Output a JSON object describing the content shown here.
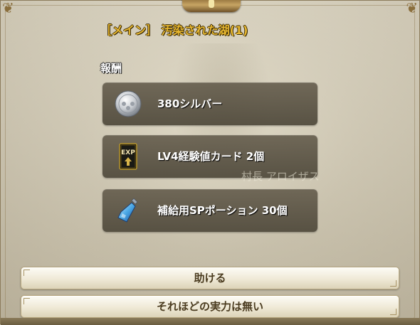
{
  "quest": {
    "title": "［メイン］ 汚染された湖(1)"
  },
  "rewards": {
    "heading": "報酬",
    "items": [
      {
        "label": "380シルバー",
        "icon": "silver-coin-icon"
      },
      {
        "label": "LV4経験値カード 2個",
        "icon": "exp-card-icon",
        "icon_text": "EXP"
      },
      {
        "label": "補給用SPポーション 30個",
        "icon": "sp-potion-icon"
      }
    ]
  },
  "npc": {
    "name": "村長 アロイザス"
  },
  "actions": {
    "accept_label": "助ける",
    "decline_label": "それほどの実力は無い"
  },
  "colors": {
    "title": "#e8b830",
    "reward_box": "#5e5646",
    "button_text": "#4a3b1f"
  }
}
